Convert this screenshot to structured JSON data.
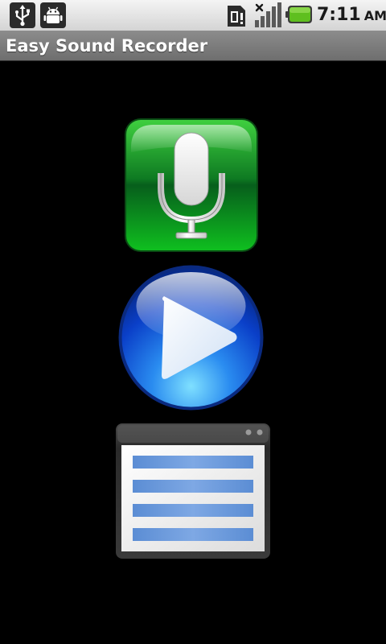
{
  "status_bar": {
    "time": "7:11",
    "ampm": "AM",
    "icons": [
      "usb-icon",
      "android-debug-icon",
      "sim-icon",
      "signal-icon",
      "battery-icon"
    ],
    "battery_color": "#5fbf1f"
  },
  "app": {
    "title": "Easy Sound Recorder",
    "title_bar_color": "#7d7d7d",
    "background_color": "#000000"
  },
  "buttons": [
    {
      "name": "record",
      "icon": "microphone-icon",
      "color": "#1a9a1a"
    },
    {
      "name": "play",
      "icon": "play-icon",
      "color": "#1f5fe0"
    },
    {
      "name": "recordings-list",
      "icon": "list-window-icon",
      "color": "#6f9ad8"
    }
  ]
}
